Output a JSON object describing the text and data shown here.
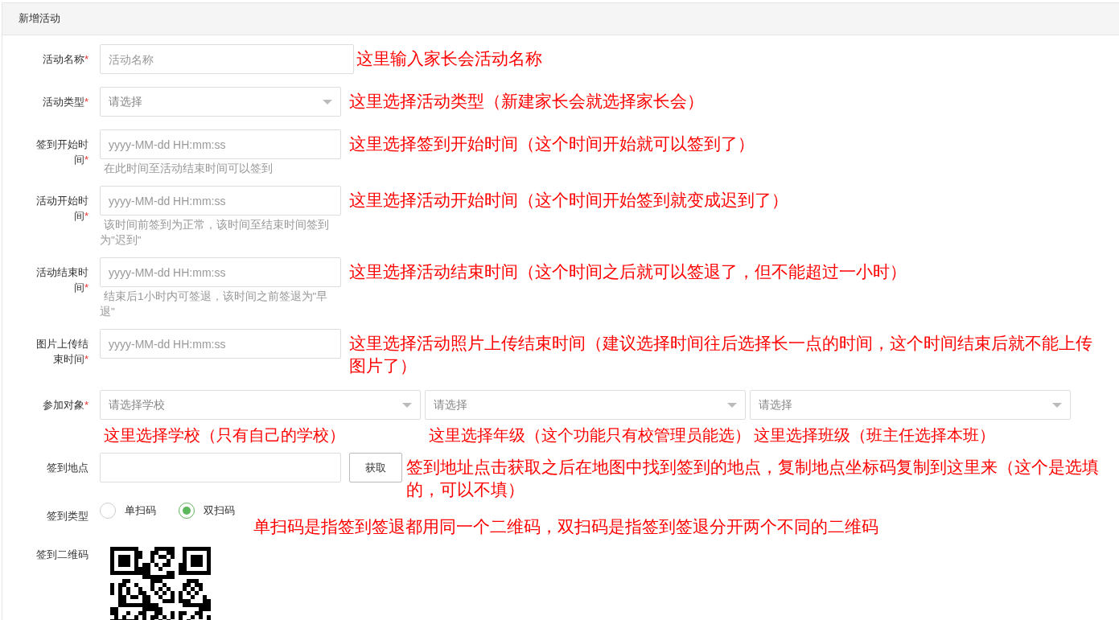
{
  "panel": {
    "title": "新增活动"
  },
  "fields": [
    {
      "kind": "text",
      "label": "活动名称",
      "required_mark": "*",
      "placeholder": "活动名称",
      "wide": true,
      "annotation": "这里输入家长会活动名称"
    },
    {
      "kind": "select",
      "label": "活动类型",
      "required_mark": "*",
      "placeholder": "请选择",
      "annotation": "这里选择活动类型（新建家长会就选择家长会）"
    },
    {
      "kind": "text",
      "label": "签到开始时间",
      "required_mark": "*",
      "placeholder": "yyyy-MM-dd HH:mm:ss",
      "help": "在此时间至活动结束时间可以签到",
      "annotation": "这里选择签到开始时间（这个时间开始就可以签到了）"
    },
    {
      "kind": "text",
      "label": "活动开始时间",
      "required_mark": "*",
      "placeholder": "yyyy-MM-dd HH:mm:ss",
      "help": "该时间前签到为正常，该时间至结束时间签到为\"迟到\"",
      "annotation": "这里选择活动开始时间（这个时间开始签到就变成迟到了）"
    },
    {
      "kind": "text",
      "label": "活动结束时间",
      "required_mark": "*",
      "placeholder": "yyyy-MM-dd HH:mm:ss",
      "help": "结束后1小时内可签退，该时间之前签退为\"早退\"",
      "annotation": "这里选择活动结束时间（这个时间之后就可以签退了，但不能超过一小时）"
    },
    {
      "kind": "text",
      "label": "图片上传结束时间",
      "required_mark": "*",
      "placeholder": "yyyy-MM-dd HH:mm:ss",
      "annotation": "这里选择活动照片上传结束时间（建议选择时间往后选择长一点的时间，这个时间结束后就不能上传图片了）"
    },
    {
      "kind": "multi_select",
      "label": "参加对象",
      "required_mark": "*",
      "selects": [
        {
          "placeholder": "请选择学校",
          "annotation": "这里选择学校（只有自己的学校）"
        },
        {
          "placeholder": "请选择",
          "annotation": "这里选择年级（这个功能只有校管理员能选）"
        },
        {
          "placeholder": "请选择",
          "annotation": "这里选择班级（班主任选择本班）"
        }
      ]
    },
    {
      "kind": "text_button",
      "label": "签到地点",
      "button": "获取",
      "annotation": "签到地址点击获取之后在地图中找到签到的地点，复制地点坐标码复制到这里来（这个是选填的，可以不填）"
    },
    {
      "kind": "radio",
      "label": "签到类型",
      "options": [
        {
          "label": "单扫码",
          "selected": false
        },
        {
          "label": "双扫码",
          "selected": true
        }
      ],
      "annotation": "单扫码是指签到签退都用同一个二维码，双扫码是指签到签退分开两个不同的二维码"
    },
    {
      "kind": "qr",
      "label": "签到二维码"
    }
  ]
}
